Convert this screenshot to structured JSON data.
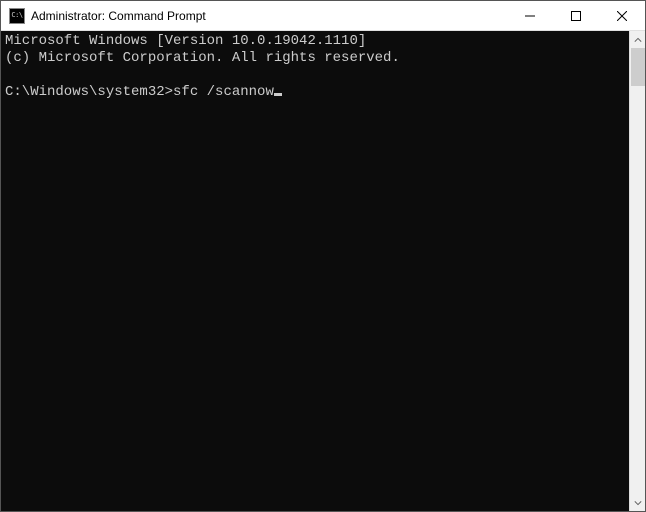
{
  "titlebar": {
    "icon_label": "C:\\",
    "title": "Administrator: Command Prompt"
  },
  "console": {
    "line1": "Microsoft Windows [Version 10.0.19042.1110]",
    "line2": "(c) Microsoft Corporation. All rights reserved.",
    "blank": "",
    "prompt": "C:\\Windows\\system32>",
    "command": "sfc /scannow"
  }
}
